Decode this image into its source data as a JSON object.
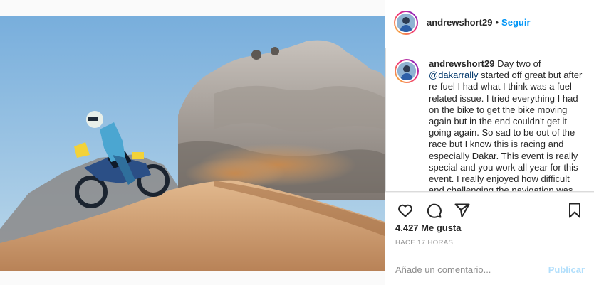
{
  "post": {
    "username": "andrewshort29",
    "follow_label": "Seguir",
    "dot": "•"
  },
  "caption": {
    "username": "andrewshort29",
    "part1": " Day two of ",
    "mention": "@dakarrally",
    "part2": " started off great but after re-fuel I had what I think was a fuel related issue. I tried everything I had on the bike to get the bike moving again but in the end couldn't get it going again. So sad to be out of the race but I know this is racing and especially Dakar. This event is really special and you work all year for this event. I really enjoyed how difficult and challenging the navigation was."
  },
  "actions": {
    "like_icon": "heart-icon",
    "comment_icon": "comment-icon",
    "share_icon": "share-icon",
    "save_icon": "bookmark-icon"
  },
  "stats": {
    "likes": "4.427 Me gusta",
    "time": "HACE 17 HORAS"
  },
  "comment_form": {
    "placeholder": "Añade un comentario...",
    "publish_label": "Publicar"
  },
  "colors": {
    "accent": "#0095f6",
    "publish_disabled": "#b2dffc",
    "mention": "#00376b"
  }
}
